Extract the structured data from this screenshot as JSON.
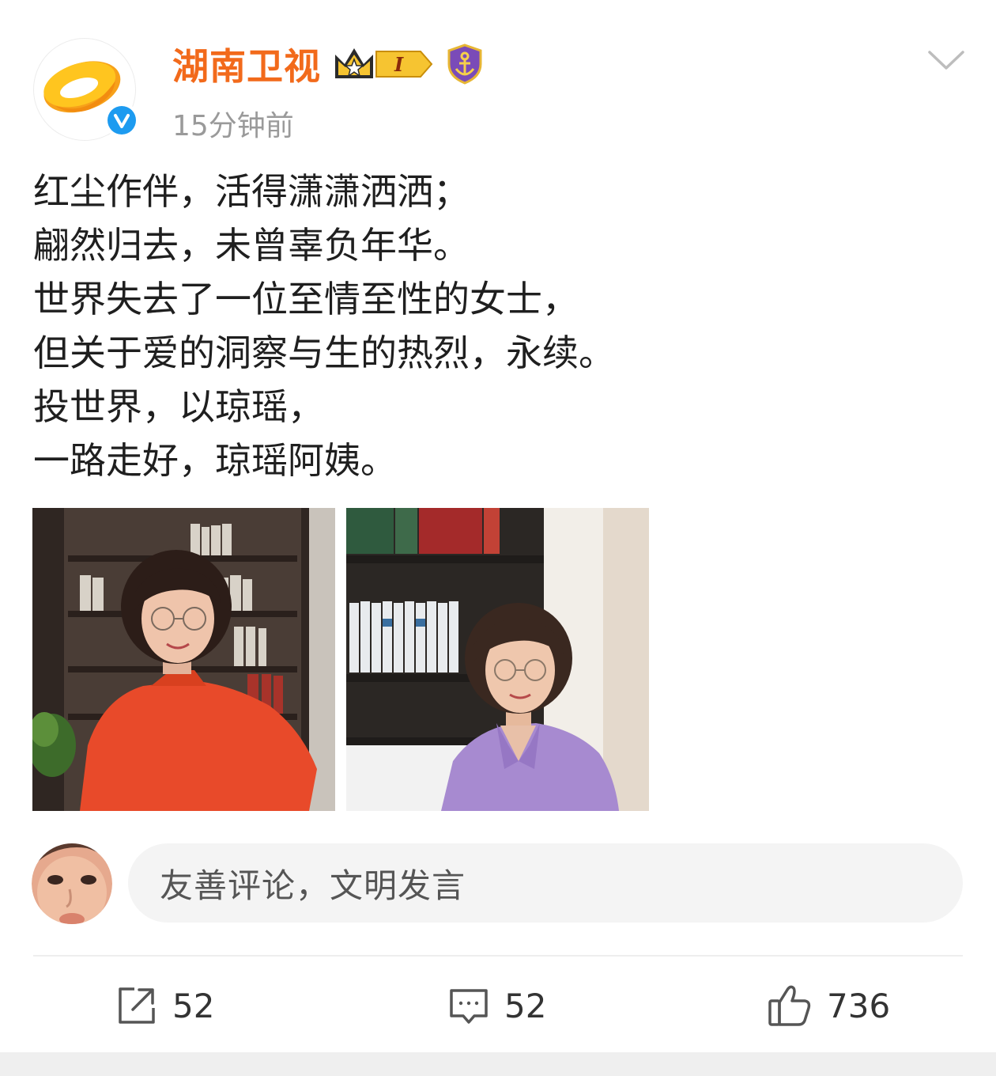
{
  "post": {
    "author": {
      "name": "湖南卫视",
      "level_badge": "I",
      "avatar_icon": "hunan-tv-logo-icon",
      "verified_icon": "verified-v-icon",
      "crown_icon": "crown-icon",
      "shield_icon": "anchor-shield-icon"
    },
    "timestamp": "15分钟前",
    "lines": [
      "红尘作伴，活得潇潇洒洒；",
      "翩然归去，未曾辜负年华。",
      "世界失去了一位至情至性的女士，",
      "但关于爱的洞察与生的热烈，永续。",
      "投世界，以琼瑶，",
      "一路走好，琼瑶阿姨。"
    ],
    "images": [
      {
        "name": "photo-woman-red-blouse-bookshelf"
      },
      {
        "name": "photo-woman-purple-blouse-bookshelf"
      }
    ]
  },
  "comment_box": {
    "placeholder": "友善评论，文明发言"
  },
  "actions": {
    "share_count": "52",
    "comment_count": "52",
    "like_count": "736"
  },
  "colors": {
    "accent": "#f26a1b",
    "muted_text": "#9a9a9a",
    "input_bg": "#f4f4f4",
    "verified_blue": "#1d9bf0"
  }
}
